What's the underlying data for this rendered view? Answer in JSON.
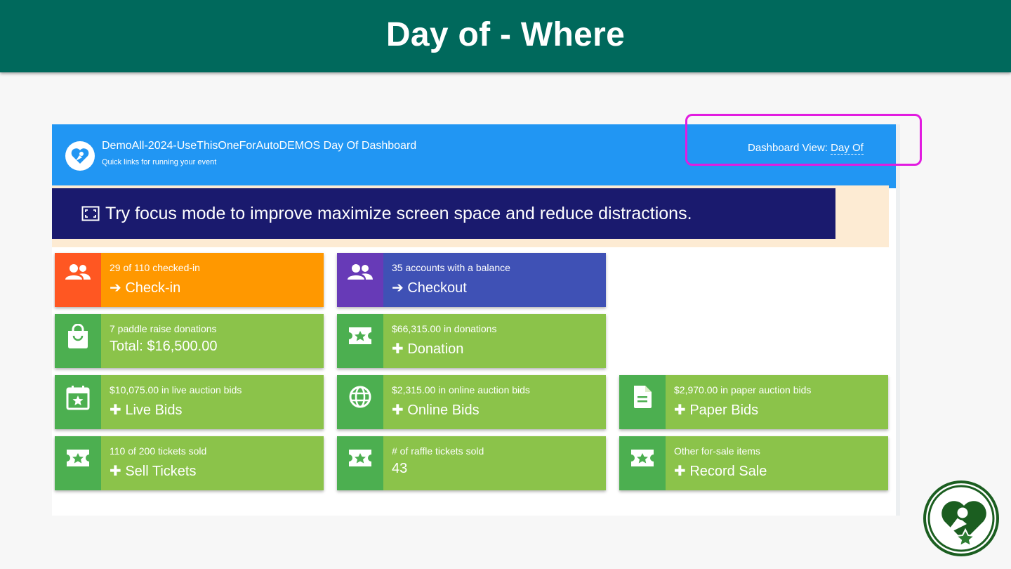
{
  "slide": {
    "title": "Day of - Where"
  },
  "dashboard": {
    "title": "DemoAll-2024-UseThisOneForAutoDEMOS Day Of Dashboard",
    "subtitle": "Quick links for running your event",
    "view_label": "Dashboard View:",
    "view_value": "Day Of"
  },
  "focus_banner": {
    "text": "Try focus mode to improve maximize screen space and reduce distractions."
  },
  "tiles": [
    {
      "icon": "people-icon",
      "sub": "29 of 110 checked-in",
      "main": "➔ Check-in"
    },
    {
      "icon": "people-icon",
      "sub": "35 accounts with a balance",
      "main": "➔ Checkout"
    },
    {
      "icon": "shopping-bag-icon",
      "sub": "7 paddle raise donations",
      "main": "Total: $16,500.00"
    },
    {
      "icon": "ticket-star-icon",
      "sub": "$66,315.00 in donations",
      "main": "Donation"
    },
    {
      "icon": "calendar-star-icon",
      "sub": "$10,075.00 in live auction bids",
      "main": "Live Bids"
    },
    {
      "icon": "globe-icon",
      "sub": "$2,315.00 in online auction bids",
      "main": "Online Bids"
    },
    {
      "icon": "document-icon",
      "sub": "$2,970.00 in paper auction bids",
      "main": "Paper Bids"
    },
    {
      "icon": "ticket-star-icon",
      "sub": "110 of 200 tickets sold",
      "main": "Sell Tickets"
    },
    {
      "icon": "ticket-star-icon",
      "sub": "# of raffle tickets sold",
      "main": "43"
    },
    {
      "icon": "ticket-star-icon",
      "sub": "Other for-sale items",
      "main": "Record Sale"
    }
  ],
  "colors": {
    "header_bg": "#00695c",
    "dashboard_header": "#2196f3",
    "focus_banner": "#1a1a6e",
    "orange": "#ff9800",
    "indigo": "#3f51b5",
    "green": "#8bc34a",
    "highlight": "#e21be0"
  }
}
